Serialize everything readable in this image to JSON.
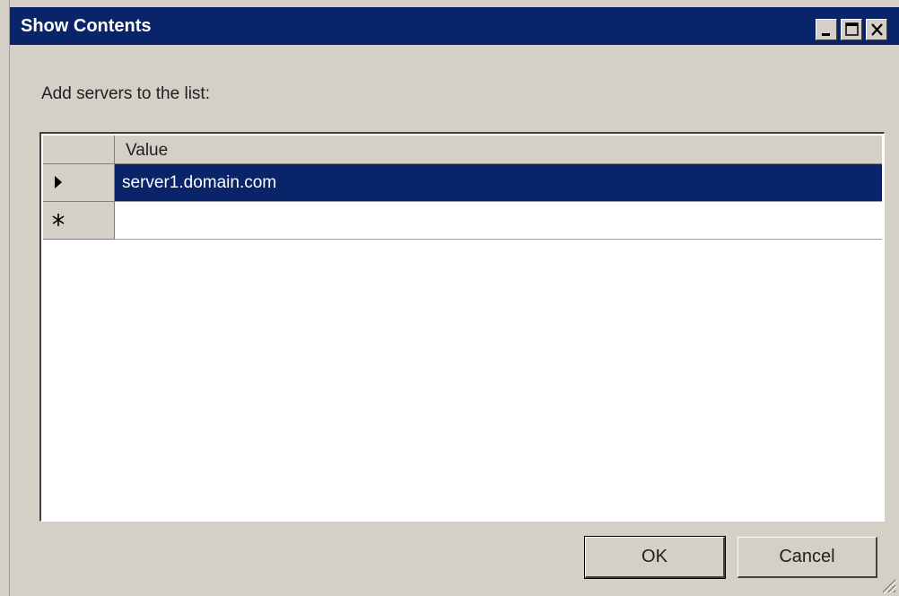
{
  "window": {
    "title": "Show Contents",
    "controls": [
      "minimize-icon",
      "maximize-icon",
      "close-icon"
    ]
  },
  "instruction": "Add servers to the list:",
  "grid": {
    "column_header": "Value",
    "rows": [
      {
        "indicator": "current-row-arrow-icon",
        "value": "server1.domain.com",
        "selected": true
      },
      {
        "indicator": "new-row-asterisk-icon",
        "value": "",
        "selected": false
      }
    ]
  },
  "buttons": {
    "ok": "OK",
    "cancel": "Cancel"
  },
  "colors": {
    "titlebar": "#0a246a",
    "selection": "#0a246a",
    "face": "#d4d0c8"
  }
}
